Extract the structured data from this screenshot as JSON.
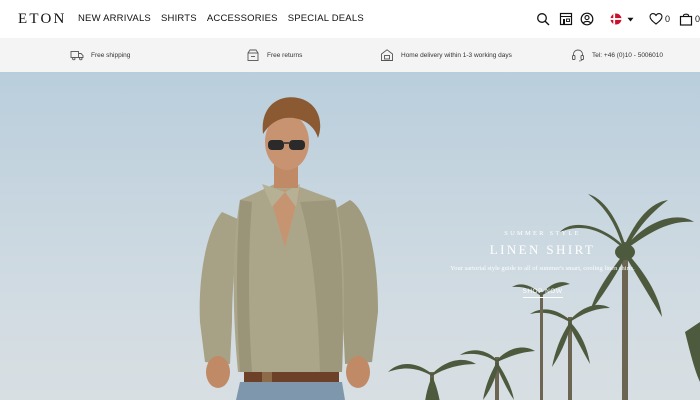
{
  "header": {
    "logo": "ETON",
    "nav": [
      "NEW ARRIVALS",
      "SHIRTS",
      "ACCESSORIES",
      "SPECIAL DEALS"
    ],
    "icons": [
      "search-icon",
      "store-locator-icon",
      "account-icon",
      "denmark-flag-icon",
      "caret-down-icon",
      "heart-icon",
      "bag-icon"
    ],
    "wishlist_count": "0",
    "bag_count": "0"
  },
  "usp": {
    "items": [
      {
        "icon": "truck-icon",
        "label": "Free shipping"
      },
      {
        "icon": "returns-box-icon",
        "label": "Free returns"
      },
      {
        "icon": "home-delivery-icon",
        "label": "Home delivery within 1-3 working days"
      },
      {
        "icon": "headset-icon",
        "label": "Tel: +46 (0)10 - 5006010"
      }
    ]
  },
  "hero": {
    "kicker": "SUMMER STYLE",
    "title": "LINEN SHIRT",
    "description": "Your sartorial style guide to all of summer's smart, cooling linen shirts.",
    "cta": "SHOP NOW",
    "sky_color": "#c5d6e2",
    "shirt_color": "#a9a487"
  }
}
